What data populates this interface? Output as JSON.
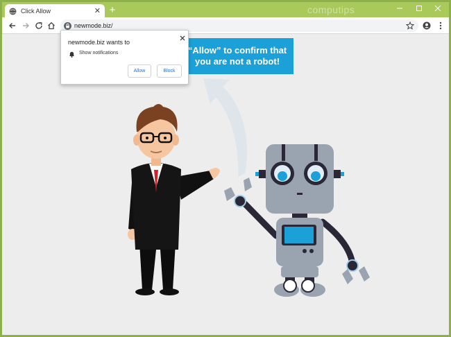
{
  "tab": {
    "title": "Click Allow",
    "favicon": "globe-icon",
    "close_icon": "close-icon"
  },
  "watermark": "computips",
  "toolbar": {
    "url": "newmode.biz/",
    "icons": [
      "back-arrow-icon",
      "forward-arrow-icon",
      "reload-icon",
      "home-icon",
      "lock-icon",
      "star-icon",
      "profile-icon",
      "menu-kebab-icon"
    ]
  },
  "banner": {
    "line1": "“Allow” to confirm that",
    "line2": "you are not a robot!"
  },
  "popup": {
    "title": "newmode.biz wants to",
    "permission": "Show notifications",
    "allow_label": "Allow",
    "block_label": "Block"
  },
  "colors": {
    "frame": "#a9c95a",
    "banner": "#1ba1d8",
    "page_bg": "#ededed",
    "button_text": "#1a73e8"
  }
}
